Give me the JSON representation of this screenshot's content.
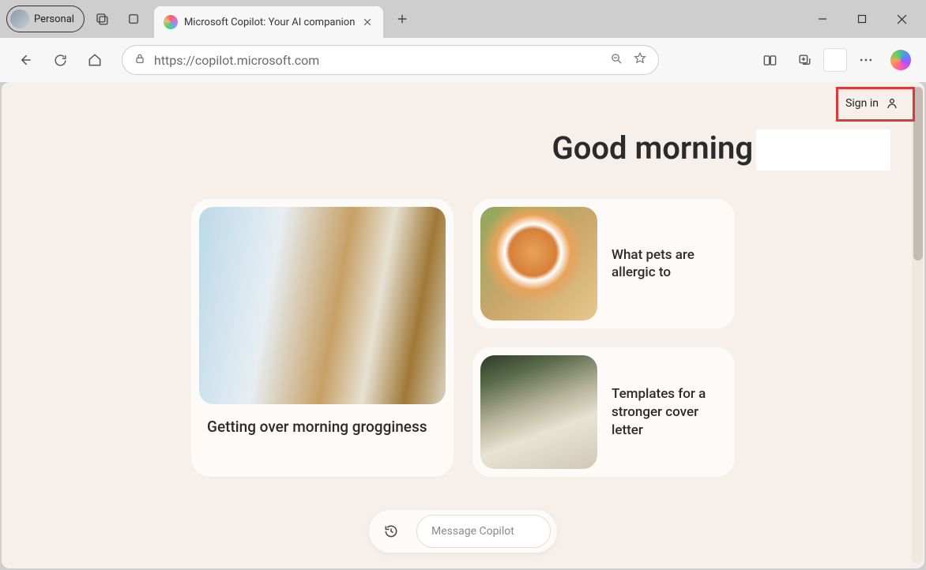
{
  "window": {
    "profile_label": "Personal",
    "tab_title": "Microsoft Copilot: Your AI companion",
    "address": "https://copilot.microsoft.com"
  },
  "page": {
    "sign_in": "Sign in",
    "greeting": "Good morning",
    "cards": {
      "large": {
        "title": "Getting over morning grogginess"
      },
      "small1": {
        "title": "What pets are allergic to"
      },
      "small2": {
        "title": "Templates for a stronger cover letter"
      }
    },
    "composer": {
      "placeholder": "Message Copilot"
    }
  }
}
